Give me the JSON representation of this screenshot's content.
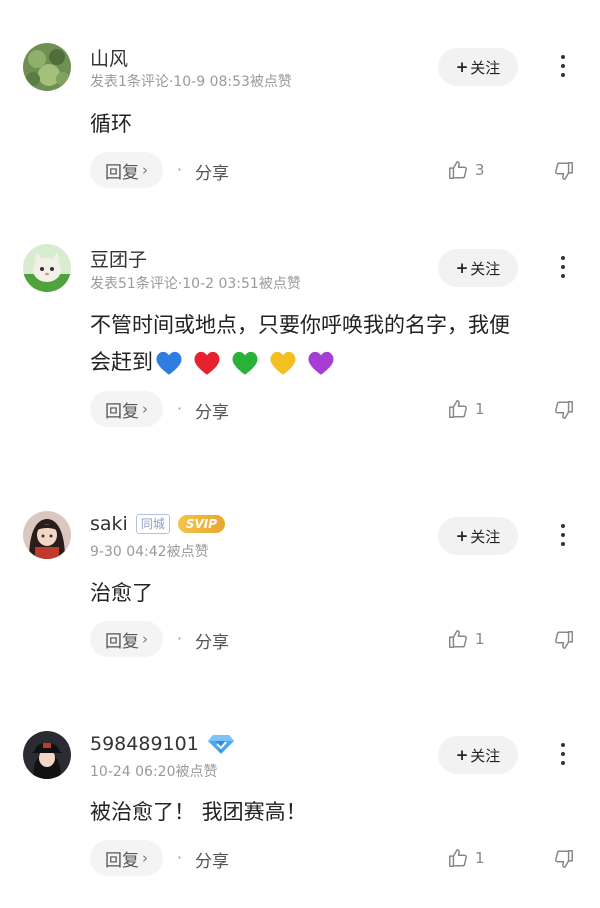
{
  "comments": [
    {
      "username": "山风",
      "meta": "发表1条评论·10-9 08:53被点赞",
      "follow": "关注",
      "content": "循环",
      "reply": "回复",
      "share": "分享",
      "likes": "3",
      "avatar_icon": "leaf-avatar"
    },
    {
      "username": "豆团子",
      "meta": "发表51条评论·10-2 03:51被点赞",
      "follow": "关注",
      "content_line1": "不管时间或地点，只要你呼唤我的名字，我便",
      "content_line2": "会赶到",
      "hearts": [
        "#2f7de1",
        "#e8212f",
        "#29b23a",
        "#f3bf22",
        "#a63ed6"
      ],
      "reply": "回复",
      "share": "分享",
      "likes": "1",
      "avatar_icon": "cat-avatar"
    },
    {
      "username": "saki",
      "tag_city": "同城",
      "tag_svip": "SVIP",
      "meta": "9-30 04:42被点赞",
      "follow": "关注",
      "content": "治愈了",
      "reply": "回复",
      "share": "分享",
      "likes": "1",
      "avatar_icon": "girl-avatar"
    },
    {
      "username": "598489101",
      "meta": "10-24 06:20被点赞",
      "follow": "关注",
      "content": "被治愈了！ 我团赛高！",
      "reply": "回复",
      "share": "分享",
      "likes": "1",
      "avatar_icon": "cap-avatar",
      "badge_icon": "diamond-icon"
    }
  ]
}
